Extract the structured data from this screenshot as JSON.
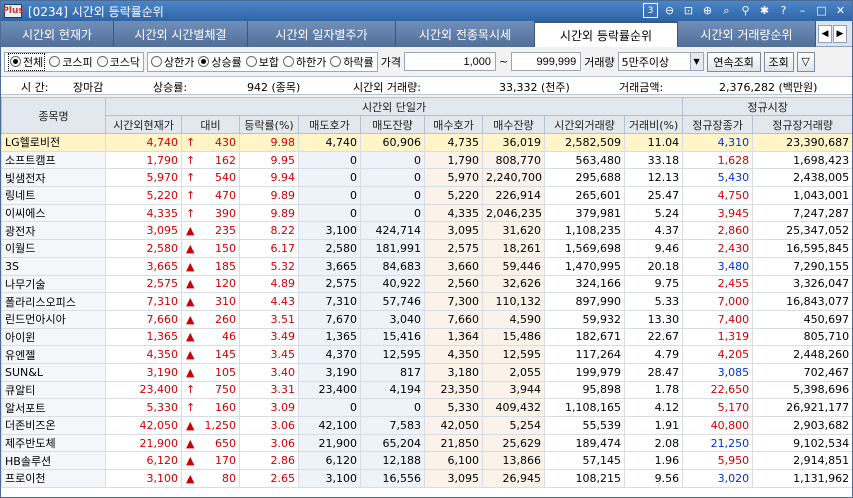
{
  "window": {
    "logo": "Plus",
    "title": "[0234] 시간외 등락률순위",
    "screen_no": "3"
  },
  "tabs": [
    {
      "label": "시간외 현재가",
      "active": false
    },
    {
      "label": "시간외 시간별체결",
      "active": false
    },
    {
      "label": "시간외 일자별주가",
      "active": false
    },
    {
      "label": "시간외 전종목시세",
      "active": false
    },
    {
      "label": "시간외 등락률순위",
      "active": true
    },
    {
      "label": "시간외 거래량순위",
      "active": false
    }
  ],
  "filters": {
    "market": [
      {
        "label": "전체",
        "checked": true
      },
      {
        "label": "코스피",
        "checked": false
      },
      {
        "label": "코스닥",
        "checked": false
      }
    ],
    "direction": [
      {
        "label": "상한가",
        "checked": false
      },
      {
        "label": "상승률",
        "checked": true
      },
      {
        "label": "보합",
        "checked": false
      },
      {
        "label": "하한가",
        "checked": false
      },
      {
        "label": "하락률",
        "checked": false
      }
    ],
    "price_label": "가격",
    "price_from": "1,000",
    "price_sep": "~",
    "price_to": "999,999",
    "volume_label": "거래량",
    "volume_value": "5만주이상",
    "continuous_btn": "연속조회",
    "query_btn": "조회"
  },
  "info": {
    "time_label": "시   간:",
    "time_value": "장마감",
    "rise_label": "상승률:",
    "rise_value": "942 (종목)",
    "vol_label": "시간외 거래량:",
    "vol_value": "33,332 (천주)",
    "amt_label": "거래금액:",
    "amt_value": "2,376,282 (백만원)"
  },
  "table": {
    "group_headers": {
      "single": "시간외 단일가",
      "regular": "정규시장"
    },
    "headers": [
      "종목명",
      "시간외현재가",
      "대비",
      "등락률(%)",
      "매도호가",
      "매도잔량",
      "매수호가",
      "매수잔량",
      "시간외거래량",
      "거래비(%)",
      "정규장종가",
      "정규장거래량"
    ],
    "rows": [
      {
        "name": "LG헬로비전",
        "price": "4,740",
        "arrow": "↑",
        "diff": "430",
        "rate": "9.98",
        "ask": "4,740",
        "ask_qty": "60,906",
        "bid": "4,735",
        "bid_qty": "36,019",
        "vol": "2,582,509",
        "ratio": "11.04",
        "close": "4,310",
        "close_color": "blue",
        "reg_vol": "23,390,687"
      },
      {
        "name": "소프트캠프",
        "price": "1,790",
        "arrow": "↑",
        "diff": "162",
        "rate": "9.95",
        "ask": "0",
        "ask_qty": "0",
        "bid": "1,790",
        "bid_qty": "808,770",
        "vol": "563,480",
        "ratio": "33.18",
        "close": "1,628",
        "close_color": "red",
        "reg_vol": "1,698,423"
      },
      {
        "name": "빛샘전자",
        "price": "5,970",
        "arrow": "↑",
        "diff": "540",
        "rate": "9.94",
        "ask": "0",
        "ask_qty": "0",
        "bid": "5,970",
        "bid_qty": "2,240,700",
        "vol": "295,688",
        "ratio": "12.13",
        "close": "5,430",
        "close_color": "blue",
        "reg_vol": "2,438,005"
      },
      {
        "name": "링네트",
        "price": "5,220",
        "arrow": "↑",
        "diff": "470",
        "rate": "9.89",
        "ask": "0",
        "ask_qty": "0",
        "bid": "5,220",
        "bid_qty": "226,914",
        "vol": "265,601",
        "ratio": "25.47",
        "close": "4,750",
        "close_color": "red",
        "reg_vol": "1,043,001"
      },
      {
        "name": "이씨에스",
        "price": "4,335",
        "arrow": "↑",
        "diff": "390",
        "rate": "9.89",
        "ask": "0",
        "ask_qty": "0",
        "bid": "4,335",
        "bid_qty": "2,046,235",
        "vol": "379,981",
        "ratio": "5.24",
        "close": "3,945",
        "close_color": "red",
        "reg_vol": "7,247,287"
      },
      {
        "name": "광전자",
        "price": "3,095",
        "arrow": "▲",
        "diff": "235",
        "rate": "8.22",
        "ask": "3,100",
        "ask_qty": "424,714",
        "bid": "3,095",
        "bid_qty": "31,620",
        "vol": "1,108,235",
        "ratio": "4.37",
        "close": "2,860",
        "close_color": "red",
        "reg_vol": "25,347,052"
      },
      {
        "name": "이월드",
        "price": "2,580",
        "arrow": "▲",
        "diff": "150",
        "rate": "6.17",
        "ask": "2,580",
        "ask_qty": "181,991",
        "bid": "2,575",
        "bid_qty": "18,261",
        "vol": "1,569,698",
        "ratio": "9.46",
        "close": "2,430",
        "close_color": "red",
        "reg_vol": "16,595,845"
      },
      {
        "name": "3S",
        "price": "3,665",
        "arrow": "▲",
        "diff": "185",
        "rate": "5.32",
        "ask": "3,665",
        "ask_qty": "84,683",
        "bid": "3,660",
        "bid_qty": "59,446",
        "vol": "1,470,995",
        "ratio": "20.18",
        "close": "3,480",
        "close_color": "blue",
        "reg_vol": "7,290,155"
      },
      {
        "name": "나무기술",
        "price": "2,575",
        "arrow": "▲",
        "diff": "120",
        "rate": "4.89",
        "ask": "2,575",
        "ask_qty": "40,922",
        "bid": "2,560",
        "bid_qty": "32,626",
        "vol": "324,166",
        "ratio": "9.75",
        "close": "2,455",
        "close_color": "red",
        "reg_vol": "3,326,047"
      },
      {
        "name": "폴라리스오피스",
        "price": "7,310",
        "arrow": "▲",
        "diff": "310",
        "rate": "4.43",
        "ask": "7,310",
        "ask_qty": "57,746",
        "bid": "7,300",
        "bid_qty": "110,132",
        "vol": "897,990",
        "ratio": "5.33",
        "close": "7,000",
        "close_color": "red",
        "reg_vol": "16,843,077"
      },
      {
        "name": "린드먼아시아",
        "price": "7,660",
        "arrow": "▲",
        "diff": "260",
        "rate": "3.51",
        "ask": "7,670",
        "ask_qty": "3,040",
        "bid": "7,660",
        "bid_qty": "4,590",
        "vol": "59,932",
        "ratio": "13.30",
        "close": "7,400",
        "close_color": "red",
        "reg_vol": "450,697"
      },
      {
        "name": "아이윈",
        "price": "1,365",
        "arrow": "▲",
        "diff": "46",
        "rate": "3.49",
        "ask": "1,365",
        "ask_qty": "15,416",
        "bid": "1,364",
        "bid_qty": "15,486",
        "vol": "182,671",
        "ratio": "22.67",
        "close": "1,319",
        "close_color": "red",
        "reg_vol": "805,710"
      },
      {
        "name": "유엔젤",
        "price": "4,350",
        "arrow": "▲",
        "diff": "145",
        "rate": "3.45",
        "ask": "4,370",
        "ask_qty": "12,595",
        "bid": "4,350",
        "bid_qty": "12,595",
        "vol": "117,264",
        "ratio": "4.79",
        "close": "4,205",
        "close_color": "red",
        "reg_vol": "2,448,260"
      },
      {
        "name": "SUN&L",
        "price": "3,190",
        "arrow": "▲",
        "diff": "105",
        "rate": "3.40",
        "ask": "3,190",
        "ask_qty": "817",
        "bid": "3,180",
        "bid_qty": "2,055",
        "vol": "199,979",
        "ratio": "28.47",
        "close": "3,085",
        "close_color": "blue",
        "reg_vol": "702,467"
      },
      {
        "name": "큐알티",
        "price": "23,400",
        "arrow": "↑",
        "diff": "750",
        "rate": "3.31",
        "ask": "23,400",
        "ask_qty": "4,194",
        "bid": "23,350",
        "bid_qty": "3,944",
        "vol": "95,898",
        "ratio": "1.78",
        "close": "22,650",
        "close_color": "red",
        "reg_vol": "5,398,696"
      },
      {
        "name": "알서포트",
        "price": "5,330",
        "arrow": "↑",
        "diff": "160",
        "rate": "3.09",
        "ask": "0",
        "ask_qty": "0",
        "bid": "5,330",
        "bid_qty": "409,432",
        "vol": "1,108,165",
        "ratio": "4.12",
        "close": "5,170",
        "close_color": "red",
        "reg_vol": "26,921,177"
      },
      {
        "name": "더존비즈온",
        "price": "42,050",
        "arrow": "▲",
        "diff": "1,250",
        "rate": "3.06",
        "ask": "42,100",
        "ask_qty": "7,583",
        "bid": "42,050",
        "bid_qty": "5,254",
        "vol": "55,539",
        "ratio": "1.91",
        "close": "40,800",
        "close_color": "red",
        "reg_vol": "2,903,682"
      },
      {
        "name": "제주반도체",
        "price": "21,900",
        "arrow": "▲",
        "diff": "650",
        "rate": "3.06",
        "ask": "21,900",
        "ask_qty": "65,204",
        "bid": "21,850",
        "bid_qty": "25,629",
        "vol": "189,474",
        "ratio": "2.08",
        "close": "21,250",
        "close_color": "blue",
        "reg_vol": "9,102,534"
      },
      {
        "name": "HB솔루션",
        "price": "6,120",
        "arrow": "▲",
        "diff": "170",
        "rate": "2.86",
        "ask": "6,120",
        "ask_qty": "12,188",
        "bid": "6,100",
        "bid_qty": "13,866",
        "vol": "57,145",
        "ratio": "1.96",
        "close": "5,950",
        "close_color": "red",
        "reg_vol": "2,914,851"
      },
      {
        "name": "프로이천",
        "price": "3,100",
        "arrow": "▲",
        "diff": "80",
        "rate": "2.65",
        "ask": "3,100",
        "ask_qty": "16,556",
        "bid": "3,095",
        "bid_qty": "26,945",
        "vol": "108,215",
        "ratio": "9.56",
        "close": "3,020",
        "close_color": "blue",
        "reg_vol": "1,131,962"
      }
    ]
  },
  "colors": {
    "up": "#d00000",
    "down": "#0033cc",
    "highlight": "#fff5c8",
    "name_brown": "#8b3a1e"
  }
}
